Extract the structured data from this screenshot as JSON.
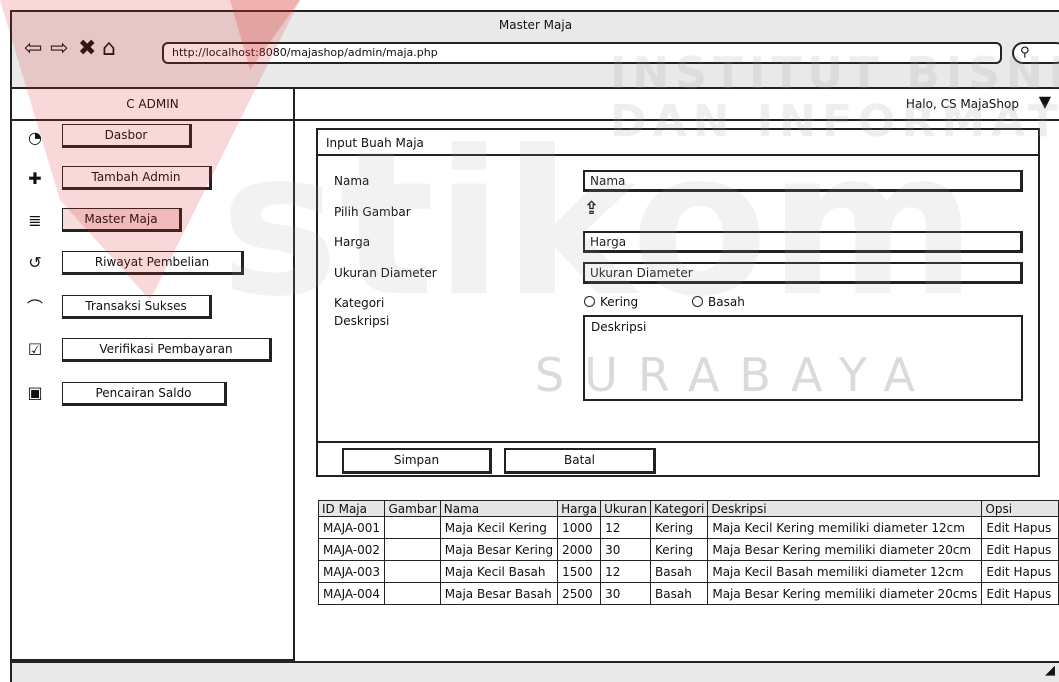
{
  "window": {
    "title": "Master Maja"
  },
  "browser": {
    "url": "http://localhost:8080/majashop/admin/maja.php",
    "search_icon": "search-icon"
  },
  "sidebar": {
    "title": "C  ADMIN",
    "items": [
      {
        "label": "Dasbor",
        "icon": "dashboard-icon",
        "glyph": "◔"
      },
      {
        "label": "Tambah Admin",
        "icon": "add-user-icon",
        "glyph": "✚"
      },
      {
        "label": "Master Maja",
        "icon": "database-icon",
        "glyph": "≣"
      },
      {
        "label": "Riwayat Pembelian",
        "icon": "history-icon",
        "glyph": "↺"
      },
      {
        "label": "Transaksi Sukses",
        "icon": "handshake-icon",
        "glyph": "⌒"
      },
      {
        "label": "Verifikasi Pembayaran",
        "icon": "check-square-icon",
        "glyph": "☑"
      },
      {
        "label": "Pencairan Saldo",
        "icon": "money-icon",
        "glyph": "▣"
      }
    ]
  },
  "header": {
    "greeting": "Halo, CS MajaShop",
    "dropdown_glyph": "▼"
  },
  "form": {
    "title": "Input Buah Maja",
    "labels": {
      "nama": "Nama",
      "gambar": "Pilih Gambar",
      "harga": "Harga",
      "ukuran": "Ukuran Diameter",
      "kategori": "Kategori",
      "deskripsi": "Deskripsi"
    },
    "fields": {
      "nama": "Nama",
      "harga": "Harga",
      "ukuran": "Ukuran Diameter",
      "deskripsi": "Deskripsi"
    },
    "upload_glyph": "⇪",
    "radio": [
      "Kering",
      "Basah"
    ],
    "buttons": {
      "save": "Simpan",
      "cancel": "Batal"
    }
  },
  "table": {
    "headers": [
      "ID Maja",
      "Gambar",
      "Nama",
      "Harga",
      "Ukuran",
      "Kategori",
      "Deskripsi",
      "Opsi"
    ],
    "rows": [
      [
        "MAJA-001",
        "",
        "Maja Kecil Kering",
        "1000",
        "12",
        "Kering",
        "Maja Kecil Kering memiliki diameter 12cm"
      ],
      [
        "MAJA-002",
        "",
        "Maja Besar Kering",
        "2000",
        "30",
        "Kering",
        "Maja Besar Kering memiliki diameter 20cm"
      ],
      [
        "MAJA-003",
        "",
        "Maja Kecil Basah",
        "1500",
        "12",
        "Basah",
        "Maja Kecil Basah memiliki diameter 12cm"
      ],
      [
        "MAJA-004",
        "",
        "Maja Besar Basah",
        "2500",
        "30",
        "Basah",
        "Maja Besar Kering memiliki diameter 20cms"
      ]
    ],
    "actions": {
      "edit": "Edit",
      "delete": "Hapus"
    }
  },
  "watermark": {
    "line1": "INSTITUT BISNIS",
    "line2": "DAN INFORMATIKA",
    "logo": "stikom",
    "city": "SURABAYA"
  }
}
